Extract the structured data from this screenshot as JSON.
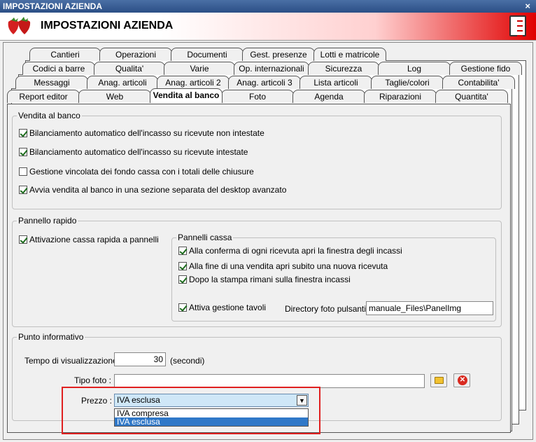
{
  "window": {
    "title": "IMPOSTAZIONI AZIENDA",
    "close_glyph": "×"
  },
  "banner": {
    "title": "IMPOSTAZIONI AZIENDA"
  },
  "tabs": {
    "row1": [
      "Cantieri",
      "Operazioni",
      "Documenti",
      "Gest. presenze",
      "Lotti e matricole"
    ],
    "row2": [
      "Codici a barre",
      "Qualita'",
      "Varie",
      "Op. internazionali",
      "Sicurezza",
      "Log",
      "Gestione fido"
    ],
    "row3": [
      "Messaggi",
      "Anag. articoli",
      "Anag. articoli 2",
      "Anag. articoli 3",
      "Lista articoli",
      "Taglie/colori",
      "Contabilita'"
    ],
    "row4": [
      "Report editor",
      "Web",
      "Vendita al banco",
      "Foto",
      "Agenda",
      "Riparazioni",
      "Quantita'"
    ],
    "active": "Vendita al banco"
  },
  "vendita": {
    "title": "Vendita al banco",
    "opt1": "Bilanciamento automatico dell'incasso su ricevute non intestate",
    "opt2": "Bilanciamento automatico dell'incasso su ricevute intestate",
    "opt3": "Gestione vincolata dei fondo cassa con i totali delle chiusure",
    "opt4": "Avvia vendita al banco in una sezione separata del desktop avanzato"
  },
  "pannello": {
    "title": "Pannello rapido",
    "attivazione": "Attivazione cassa rapida a pannelli",
    "cassa_title": "Pannelli cassa",
    "c1": "Alla conferma di ogni ricevuta apri la finestra degli incassi",
    "c2": "Alla fine di una vendita apri subito una nuova ricevuta",
    "c3": "Dopo la stampa rimani sulla finestra incassi",
    "tavoli": "Attiva gestione tavoli",
    "dir_label": "Directory foto pulsanti :",
    "dir_value": "manuale_Files\\PanelImg"
  },
  "punto": {
    "title": "Punto informativo",
    "tempo_label": "Tempo di visualizzazione :",
    "tempo_value": "30",
    "tempo_unit": "(secondi)",
    "tipo_label": "Tipo foto :",
    "tipo_value": "",
    "prezzo_label": "Prezzo :",
    "prezzo_value": "IVA esclusa",
    "options": [
      "IVA compresa",
      "IVA esclusa"
    ]
  }
}
